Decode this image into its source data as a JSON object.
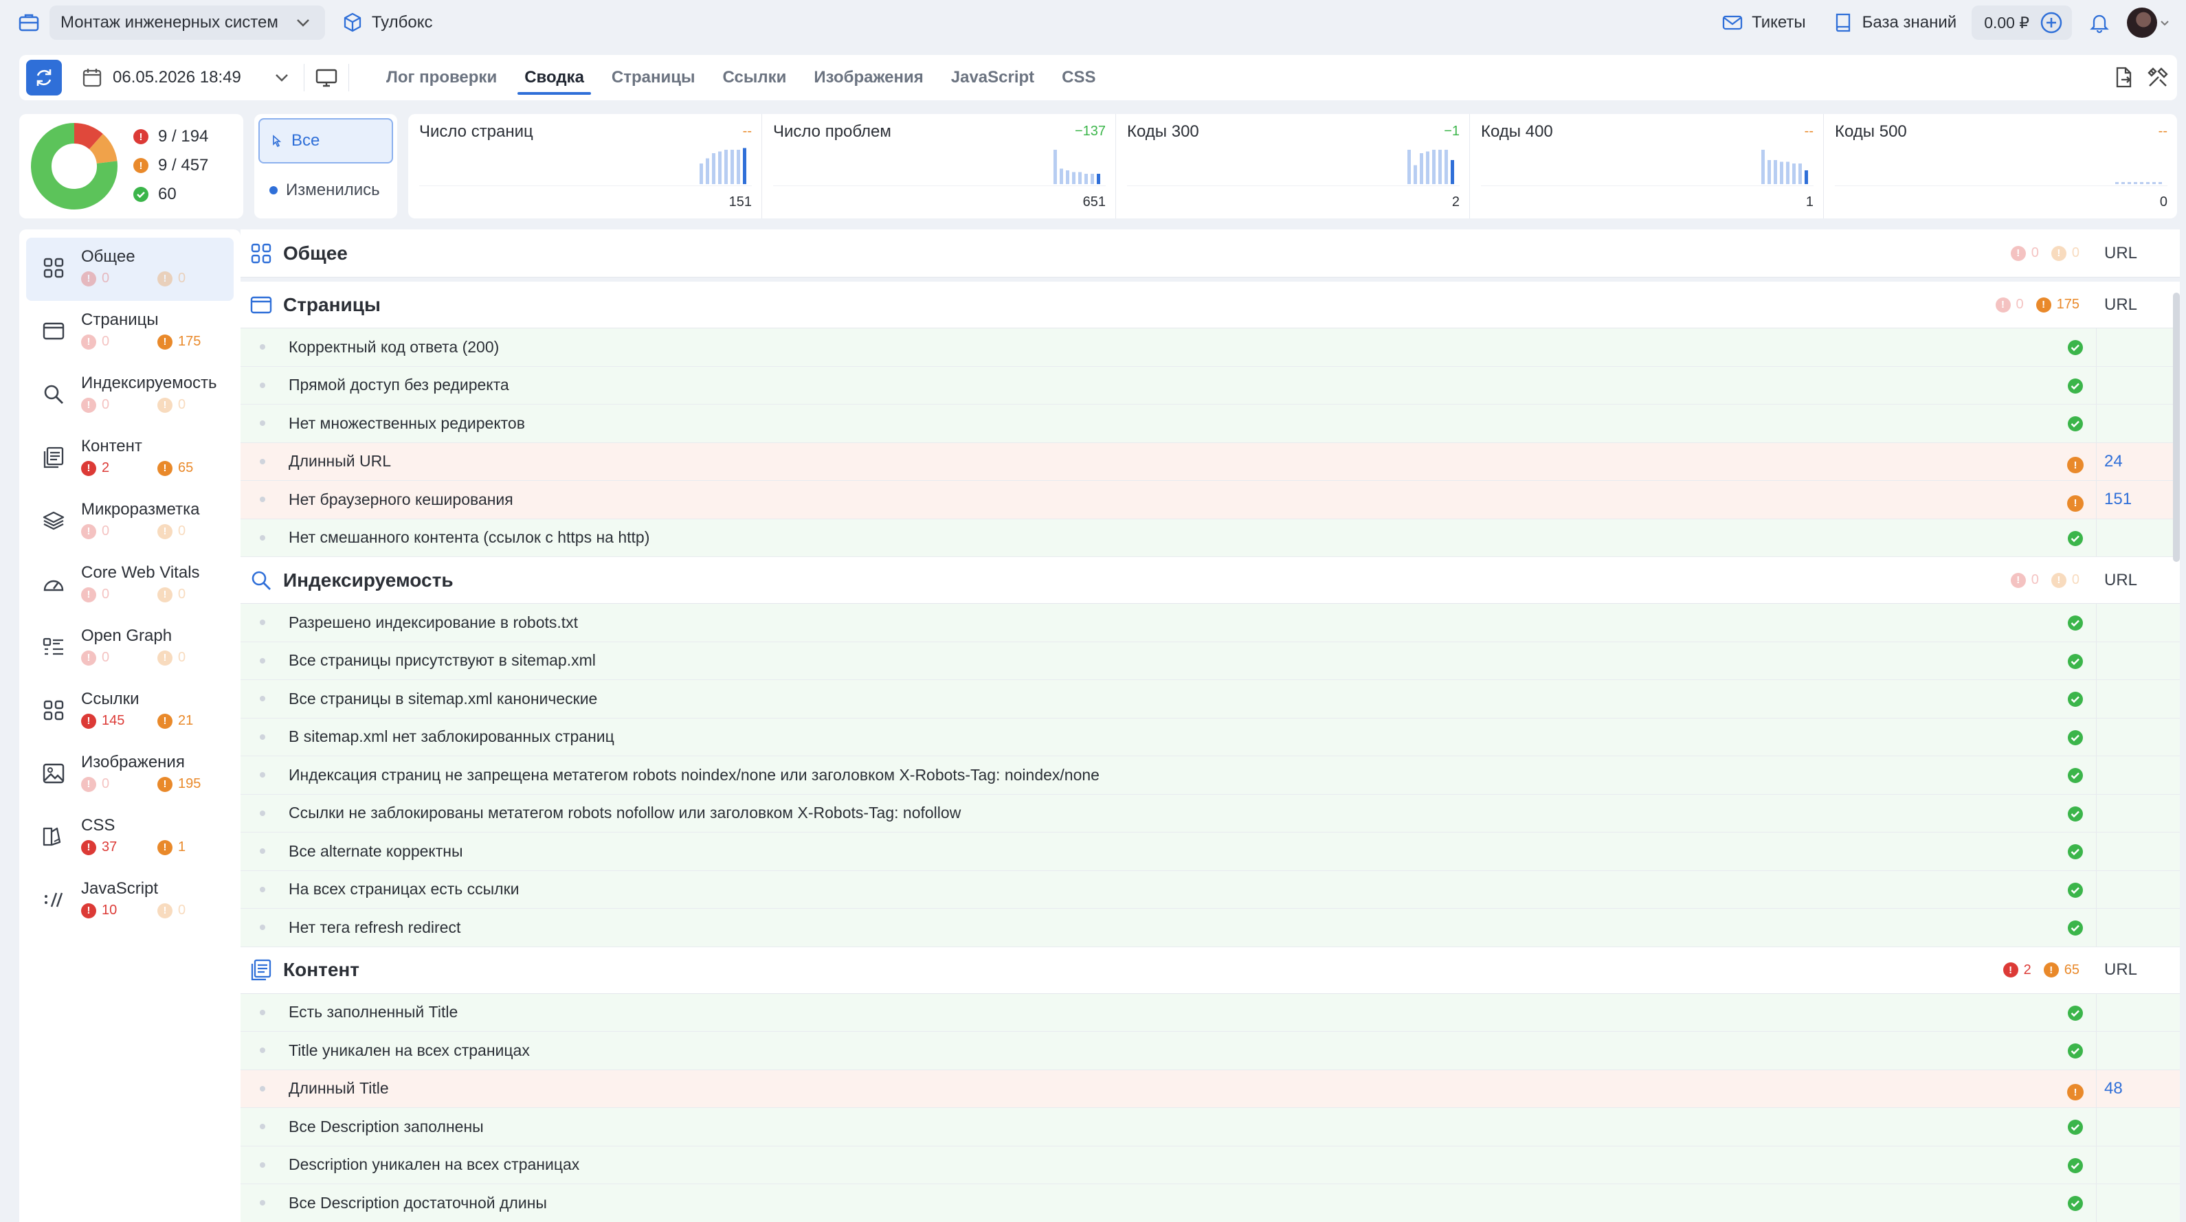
{
  "topbar": {
    "project": "Монтаж инженерных систем",
    "toolbox": "Тулбокс",
    "tickets": "Тикеты",
    "knowledge": "База знаний",
    "balance": "0.00 ₽"
  },
  "toolbar": {
    "date": "06.05.2026 18:49",
    "tabs": [
      "Лог проверки",
      "Сводка",
      "Страницы",
      "Ссылки",
      "Изображения",
      "JavaScript",
      "CSS"
    ],
    "active_tab": "Сводка"
  },
  "summary": {
    "donut": {
      "errors": 9,
      "warnings": 9,
      "ok": 60
    },
    "errors": "9 / 194",
    "warnings": "9 / 457",
    "ok": "60",
    "filters": [
      "Все",
      "Изменились"
    ]
  },
  "metrics": [
    {
      "name": "Число страниц",
      "delta": "--",
      "total": "151",
      "bars": [
        0.6,
        0.75,
        0.9,
        0.95,
        1,
        1,
        1,
        1.05
      ]
    },
    {
      "name": "Число проблем",
      "delta": "−137",
      "total": "651",
      "bars": [
        1,
        0.45,
        0.4,
        0.35,
        0.35,
        0.3,
        0.3,
        0.3
      ]
    },
    {
      "name": "Коды 300",
      "delta": "−1",
      "total": "2",
      "bars": [
        1,
        0.55,
        0.9,
        0.95,
        1,
        1,
        1,
        0.7
      ]
    },
    {
      "name": "Коды 400",
      "delta": "--",
      "total": "1",
      "bars": [
        1,
        0.7,
        0.7,
        0.65,
        0.65,
        0.6,
        0.6,
        0.4
      ]
    },
    {
      "name": "Коды 500",
      "delta": "--",
      "total": "0",
      "bars": [
        0,
        0,
        0,
        0,
        0,
        0,
        0,
        0
      ]
    }
  ],
  "sidebar": [
    {
      "label": "Общее",
      "err": "0",
      "warn": "0",
      "icon": "grid-icon"
    },
    {
      "label": "Страницы",
      "err": "0",
      "warn": "175",
      "icon": "browser-window-icon"
    },
    {
      "label": "Индексируемость",
      "err": "0",
      "warn": "0",
      "icon": "search-icon"
    },
    {
      "label": "Контент",
      "err": "2",
      "warn": "65",
      "icon": "document-icon"
    },
    {
      "label": "Микроразметка",
      "err": "0",
      "warn": "0",
      "icon": "layers-icon"
    },
    {
      "label": "Core Web Vitals",
      "err": "0",
      "warn": "0",
      "icon": "gauge-icon"
    },
    {
      "label": "Open Graph",
      "err": "0",
      "warn": "0",
      "icon": "list-icon"
    },
    {
      "label": "Ссылки",
      "err": "145",
      "warn": "21",
      "icon": "grid-icon"
    },
    {
      "label": "Изображения",
      "err": "0",
      "warn": "195",
      "icon": "image-icon"
    },
    {
      "label": "CSS",
      "err": "37",
      "warn": "1",
      "icon": "css-icon"
    },
    {
      "label": "JavaScript",
      "err": "10",
      "warn": "0",
      "icon": "javascript-icon"
    }
  ],
  "url_label": "URL",
  "sections": [
    {
      "title": "Общее",
      "err": "0",
      "warn": "0",
      "icon": "grid-icon",
      "rows": []
    },
    {
      "title": "Страницы",
      "err": "0",
      "warn": "175",
      "icon": "browser-window-icon",
      "rows": [
        {
          "text": "Корректный код ответа (200)",
          "status": "ok"
        },
        {
          "text": "Прямой доступ без редиректа",
          "status": "ok"
        },
        {
          "text": "Нет множественных редиректов",
          "status": "ok"
        },
        {
          "text": "Длинный URL",
          "status": "warn",
          "count": "24"
        },
        {
          "text": "Нет браузерного кеширования",
          "status": "warn",
          "count": "151"
        },
        {
          "text": "Нет смешанного контента (ссылок с https на http)",
          "status": "ok"
        }
      ]
    },
    {
      "title": "Индексируемость",
      "err": "0",
      "warn": "0",
      "icon": "search-icon",
      "rows": [
        {
          "text": "Разрешено индексирование в robots.txt",
          "status": "ok"
        },
        {
          "text": "Все страницы присутствуют в sitemap.xml",
          "status": "ok"
        },
        {
          "text": "Все страницы в sitemap.xml канонические",
          "status": "ok"
        },
        {
          "text": "В sitemap.xml нет заблокированных страниц",
          "status": "ok"
        },
        {
          "text": "Индексация страниц не запрещена метатегом robots noindex/none или заголовком X-Robots-Tag: noindex/none",
          "status": "ok"
        },
        {
          "text": "Ссылки не заблокированы метатегом robots nofollow или заголовком X-Robots-Tag: nofollow",
          "status": "ok"
        },
        {
          "text": "Все alternate корректны",
          "status": "ok"
        },
        {
          "text": "На всех страницах есть ссылки",
          "status": "ok"
        },
        {
          "text": "Нет тега refresh redirect",
          "status": "ok"
        }
      ]
    },
    {
      "title": "Контент",
      "err": "2",
      "warn": "65",
      "icon": "document-icon",
      "rows": [
        {
          "text": "Есть заполненный Title",
          "status": "ok"
        },
        {
          "text": "Title уникален на всех страницах",
          "status": "ok"
        },
        {
          "text": "Длинный Title",
          "status": "warn",
          "count": "48"
        },
        {
          "text": "Все Description заполнены",
          "status": "ok"
        },
        {
          "text": "Description уникален на всех страницах",
          "status": "ok"
        },
        {
          "text": "Все Description достаточной длины",
          "status": "ok"
        }
      ]
    }
  ],
  "colors": {
    "accent": "#2f6fd8",
    "error": "#dc3a36",
    "warning": "#e9892a",
    "ok": "#3bb54a"
  }
}
